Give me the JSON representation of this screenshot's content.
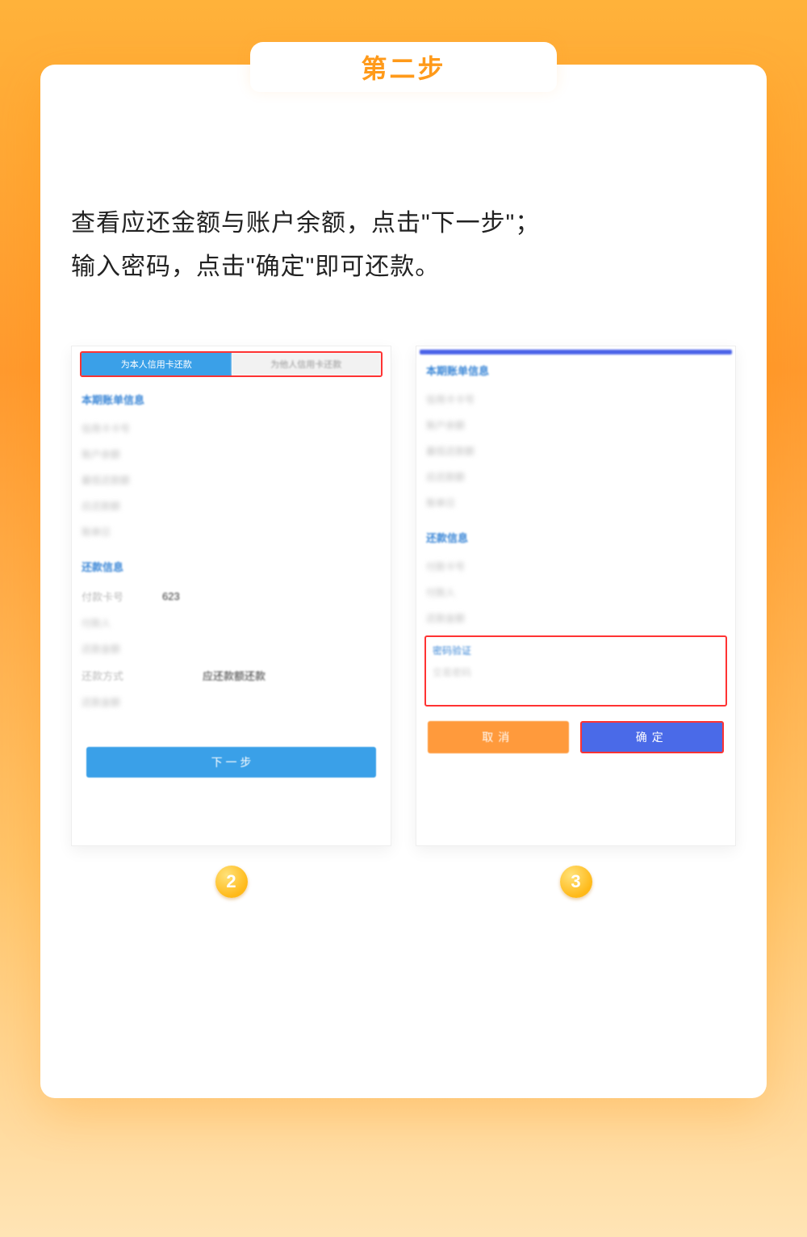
{
  "ribbon": {
    "title": "第二步"
  },
  "description": {
    "line1": "查看应还金额与账户余额，点击\"下一步\"；",
    "line2": "输入密码，点击\"确定\"即可还款。"
  },
  "left_shot": {
    "tab_active": "为本人信用卡还款",
    "tab_inactive": "为他人信用卡还款",
    "section1_title": "本期账单信息",
    "rows1": [
      {
        "label": "信用卡卡号",
        "value": ""
      },
      {
        "label": "账户余额",
        "value": ""
      },
      {
        "label": "最低还款额",
        "value": ""
      },
      {
        "label": "应还款额",
        "value": ""
      },
      {
        "label": "账单日",
        "value": ""
      }
    ],
    "section2_title": "还款信息",
    "row_card": {
      "label": "付款卡号",
      "value": "623"
    },
    "rows2": [
      {
        "label": "付款人",
        "value": ""
      },
      {
        "label": "还款金额",
        "value": ""
      }
    ],
    "row_type": {
      "label": "还款方式",
      "value": "应还款额还款"
    },
    "rows3": [
      {
        "label": "还款金额",
        "value": ""
      }
    ],
    "next_btn": "下 一 步"
  },
  "right_shot": {
    "section1_title": "本期账单信息",
    "rows1": [
      {
        "label": "信用卡卡号",
        "value": ""
      },
      {
        "label": "账户余额",
        "value": ""
      },
      {
        "label": "最低还款额",
        "value": ""
      },
      {
        "label": "应还款额",
        "value": ""
      },
      {
        "label": "账单日",
        "value": ""
      }
    ],
    "section2_title": "还款信息",
    "rows2": [
      {
        "label": "付款卡号",
        "value": ""
      },
      {
        "label": "付款人",
        "value": ""
      },
      {
        "label": "还款金额",
        "value": ""
      }
    ],
    "pw_title": "密码验证",
    "pw_field": "交易密码",
    "cancel_btn": "取消",
    "confirm_btn": "确定"
  },
  "badges": {
    "left": "2",
    "right": "3"
  }
}
